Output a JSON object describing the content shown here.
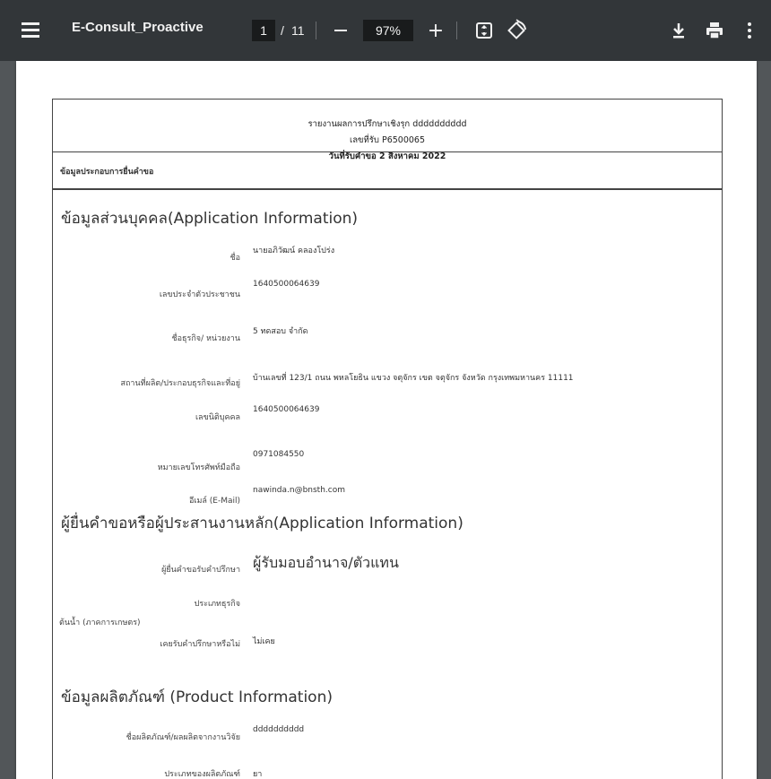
{
  "toolbar": {
    "menu_icon": "hamburger-menu-icon",
    "title": "E-Consult_Proactive",
    "page_current": "1",
    "page_sep": "/",
    "page_total": "11",
    "zoom": "97%",
    "zoom_in": "+",
    "icons": [
      "minus-icon",
      "plus-icon",
      "fit-page-icon",
      "rotate-icon",
      "download-icon",
      "print-icon",
      "more-vert-icon"
    ]
  },
  "doc": {
    "header_line1": "รายงานผลการปรึกษาเชิงรุก dddddddddd",
    "header_line2": "เลขที่รับ P6500065",
    "header_line3": "วันที่รับคำขอ 2 สิงหาคม 2022",
    "subheader": "ข้อมูลประกอบการยื่นคำขอ",
    "section1": "ข้อมูลส่วนบุคคล(Application Information)",
    "s1": [
      {
        "label": "ชื่อ",
        "value": "นายอภิวัฒน์ คลองโปร่ง"
      },
      {
        "label": "เลขประจำตัวประชาชน",
        "value": "1640500064639"
      },
      {
        "label": "ชื่อธุรกิจ/ หน่วยงาน",
        "value": "5 ทดสอบ จำกัด"
      },
      {
        "label": "สถานที่ผลิต/ประกอบธุรกิจและที่อยู่",
        "value": "บ้านเลขที่ 123/1 ถนน พหลโยธิน แขวง จตุจักร เขต จตุจักร จังหวัด กรุงเทพมหานคร 11111"
      },
      {
        "label": "เลขนิติบุคคล",
        "value": "1640500064639"
      },
      {
        "label": "หมายเลขโทรศัพท์มือถือ",
        "value": "0971084550"
      },
      {
        "label": "อีเมล์ (E-Mail)",
        "value": "nawinda.n@bnsth.com"
      }
    ],
    "section2": "ผู้ยื่นคำขอหรือผู้ประสานงานหลัก(Application Information)",
    "s2": [
      {
        "label": "ผู้ยื่นคำขอรับคำปรึกษา",
        "value": "ผู้รับมอบอำนาจ/ตัวแทน"
      },
      {
        "label": "ประเภทธุรกิจ",
        "value": ""
      },
      {
        "label": "เคยรับคำปรึกษาหรือไม่",
        "value": "ไม่เคย"
      }
    ],
    "left_note": "ต้นน้ำ (ภาคการเกษตร)",
    "section3": "ข้อมูลผลิตภัณฑ์ (Product Information)",
    "s3": [
      {
        "label": "ชื่อผลิตภัณฑ์/ผลผลิตจากงานวิจัย",
        "value": "dddddddddd"
      },
      {
        "label": "ประเภทของผลิตภัณฑ์",
        "value": "ยา"
      }
    ]
  }
}
